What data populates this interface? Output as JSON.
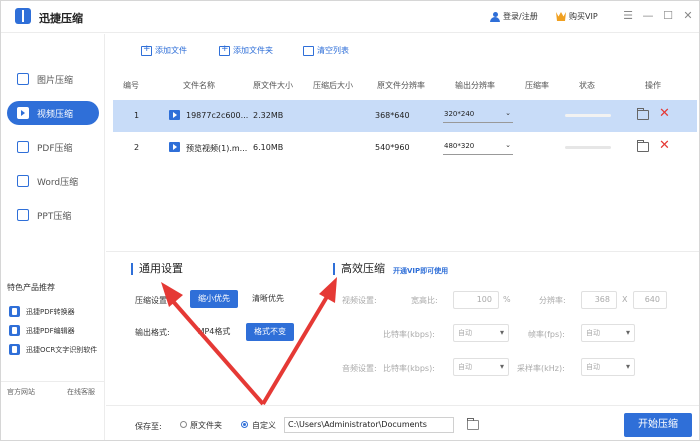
{
  "window": {
    "title": "迅捷压缩",
    "login_label": "登录/注册",
    "vip_label": "购买VIP",
    "min_glyph": "—",
    "max_glyph": "☐",
    "close_glyph": "✕",
    "menu_glyph": "☰"
  },
  "sidebar": {
    "items": [
      {
        "label": "图片压缩",
        "active": false
      },
      {
        "label": "视频压缩",
        "active": true
      },
      {
        "label": "PDF压缩",
        "active": false
      },
      {
        "label": "Word压缩",
        "active": false
      },
      {
        "label": "PPT压缩",
        "active": false
      }
    ],
    "recommend_title": "特色产品推荐",
    "recommend": [
      "迅捷PDF转换器",
      "迅捷PDF编辑器",
      "迅捷OCR文字识别软件"
    ],
    "footer": {
      "website": "官方网站",
      "support": "在线客服"
    }
  },
  "toolbar": {
    "add_file": "添加文件",
    "add_folder": "添加文件夹",
    "clear_list": "清空列表"
  },
  "table": {
    "headers": [
      "编号",
      "文件名称",
      "原文件大小",
      "压缩后大小",
      "原文件分辨率",
      "输出分辨率",
      "压缩率",
      "状态",
      "操作"
    ],
    "rows": [
      {
        "no": "1",
        "name": "19877c2c600...",
        "size": "2.32MB",
        "compressed": "",
        "res": "368*640",
        "out_res": "320*240",
        "ratio": "",
        "selected": true
      },
      {
        "no": "2",
        "name": "预览视频(1).m...",
        "size": "6.10MB",
        "compressed": "",
        "res": "540*960",
        "out_res": "480*320",
        "ratio": "",
        "selected": false
      }
    ]
  },
  "general": {
    "title": "通用设置",
    "compress_label": "压缩设置:",
    "compress_opt1": "缩小优先",
    "compress_opt2": "清晰优先",
    "output_label": "输出格式:",
    "output_opt1": "MP4格式",
    "output_opt2": "格式不变"
  },
  "advanced": {
    "title": "高效压缩",
    "vip_link": "开通VIP即可使用",
    "video_label": "视频设置:",
    "aspect_label": "宽高比:",
    "aspect_value": "100",
    "aspect_unit": "%",
    "resolution_label": "分辨率:",
    "res_w": "368",
    "res_x": "X",
    "res_h": "640",
    "bitrate_label": "比特率(kbps):",
    "bitrate_value": "自动",
    "fps_label": "帧率(fps):",
    "fps_value": "自动",
    "audio_label": "音频设置:",
    "audio_bitrate_label": "比特率(kbps):",
    "audio_bitrate_value": "自动",
    "sample_label": "采样率(kHz):",
    "sample_value": "自动"
  },
  "bottom": {
    "save_label": "保存至:",
    "opt_original": "原文件夹",
    "opt_custom": "自定义",
    "path": "C:\\Users\\Administrator\\Documents",
    "start_button": "开始压缩"
  },
  "colors": {
    "accent": "#2f6fd8",
    "selected_row": "#c8dcf8",
    "arrow": "#e53935"
  }
}
